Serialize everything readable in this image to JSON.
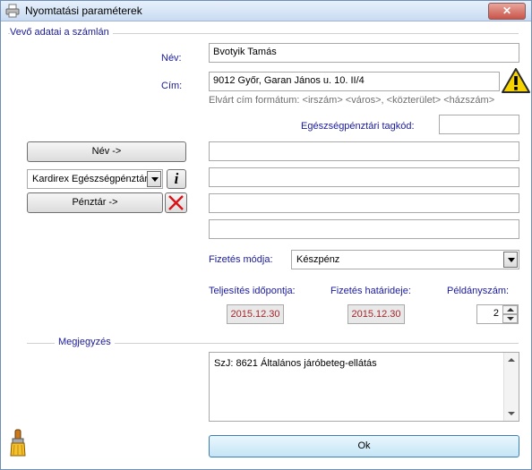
{
  "window": {
    "title": "Nyomtatási paraméterek",
    "close_label": "✕"
  },
  "group_buyer": {
    "title": "Vevő adatai a számlán"
  },
  "name_field": {
    "label": "Név:",
    "value": "Bvotyik Tamás"
  },
  "address_field": {
    "label": "Cím:",
    "value": "9012 Győr, Garan János u. 10. II/4",
    "hint": "Elvárt cím formátum: <irszám> <város>, <közterület> <házszám>"
  },
  "health_fund": {
    "label": "Egészségpénztári tagkód:",
    "value": ""
  },
  "buttons": {
    "name_copy": "Név ->",
    "fund_copy": "Pénztár ->",
    "ok": "Ok"
  },
  "fund_select": {
    "value": "Kardirex Egészségpénztár",
    "info_glyph": "i"
  },
  "extra_lines": [
    "",
    "",
    "",
    ""
  ],
  "payment": {
    "label": "Fizetés módja:",
    "value": "Készpénz"
  },
  "performance_date": {
    "label": "Teljesítés időpontja:",
    "value": "2015.12.30"
  },
  "due_date": {
    "label": "Fizetés határideje:",
    "value": "2015.12.30"
  },
  "copies": {
    "label": "Példányszám:",
    "value": "2"
  },
  "group_notes": {
    "title": "Megjegyzés"
  },
  "notes": {
    "value": "SzJ: 8621 Általános járóbeteg-ellátás"
  },
  "colors": {
    "label_blue": "#1a1a9c",
    "date_red": "#a4262c",
    "warning_yellow": "#f6d200",
    "delete_red": "#d8141a"
  },
  "icons": {
    "app": "printer-icon",
    "warning": "warning-icon",
    "info": "info-icon",
    "delete": "delete-x-icon",
    "clear": "brush-icon"
  }
}
